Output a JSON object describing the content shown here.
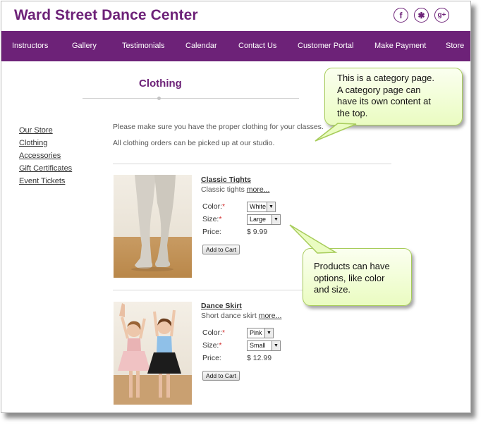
{
  "site": {
    "title": "Ward Street Dance Center"
  },
  "social": [
    {
      "icon": "facebook-icon",
      "glyph": "f"
    },
    {
      "icon": "yelp-icon",
      "glyph": "✱"
    },
    {
      "icon": "google-plus-icon",
      "glyph": "g+"
    }
  ],
  "nav": {
    "items": [
      "Instructors",
      "Gallery",
      "Testimonials",
      "Calendar",
      "Contact Us",
      "Customer Portal",
      "Make Payment",
      "Store"
    ]
  },
  "page": {
    "heading": "Clothing"
  },
  "sidebar": {
    "items": [
      "Our Store",
      "Clothing",
      "Accessories",
      "Gift Certificates",
      "Event Tickets"
    ]
  },
  "intro": {
    "line1": "Please make sure you have the proper clothing for your classes.",
    "line2": "All clothing orders can be picked up at our studio."
  },
  "products": [
    {
      "name": "Classic Tights",
      "desc": "Classic tights",
      "more": "more...",
      "color_label": "Color:",
      "color_value": "White",
      "size_label": "Size:",
      "size_value": "Large",
      "price_label": "Price:",
      "price": "$ 9.99",
      "cart": "Add to Cart"
    },
    {
      "name": "Dance Skirt",
      "desc": "Short dance skirt",
      "more": "more...",
      "color_label": "Color:",
      "color_value": "Pink",
      "size_label": "Size:",
      "size_value": "Small",
      "price_label": "Price:",
      "price": "$ 12.99",
      "cart": "Add to Cart"
    }
  ],
  "required_mark": "*",
  "callouts": {
    "category": [
      "This is a category page.",
      "A category page can",
      "have its own content at",
      "the top."
    ],
    "products": [
      "Products can have",
      "options, like color",
      "and size."
    ]
  },
  "colors": {
    "brand": "#6d2278",
    "callout_fill": "#eafcc1",
    "callout_border": "#a7cc5a",
    "required": "#d12b2b"
  }
}
